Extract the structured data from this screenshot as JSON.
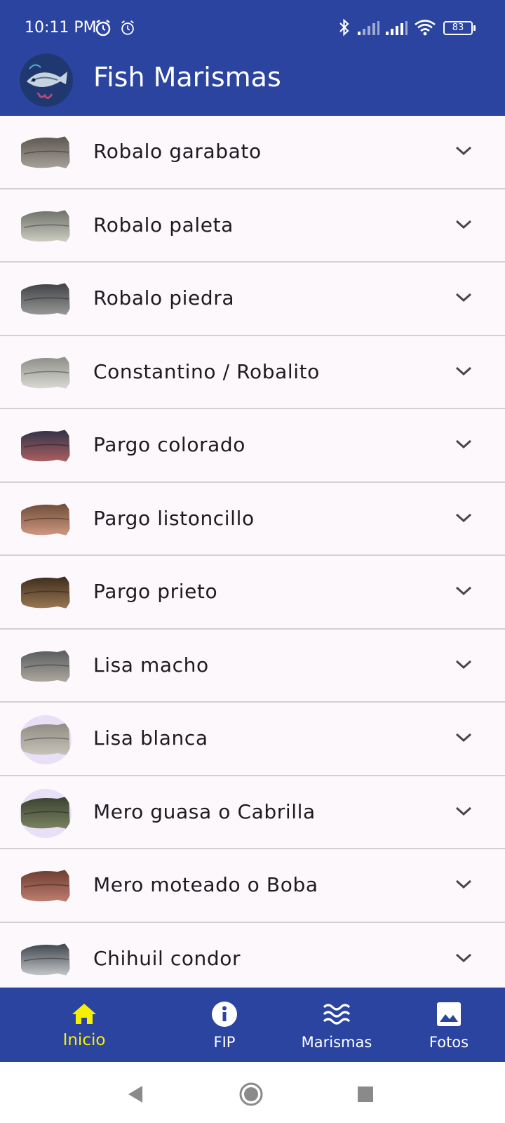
{
  "status": {
    "time": "10:11 PM",
    "battery": "83"
  },
  "app": {
    "title": "Fish Marismas"
  },
  "fish_list": [
    {
      "label": "Robalo garabato",
      "thumb": "robalo-garabato-thumb",
      "colors": [
        "#5a5550",
        "#a9a39a"
      ]
    },
    {
      "label": "Robalo paleta",
      "thumb": "robalo-paleta-thumb",
      "colors": [
        "#6b6f66",
        "#cfd0c6"
      ]
    },
    {
      "label": "Robalo piedra",
      "thumb": "robalo-piedra-thumb",
      "colors": [
        "#3c3e40",
        "#9a9c9a"
      ]
    },
    {
      "label": "Constantino / Robalito",
      "thumb": "constantino-thumb",
      "colors": [
        "#8a8c86",
        "#dcdcd6"
      ]
    },
    {
      "label": "Pargo colorado",
      "thumb": "pargo-colorado-thumb",
      "colors": [
        "#2b3248",
        "#b06060"
      ]
    },
    {
      "label": "Pargo listoncillo",
      "thumb": "pargo-listoncillo-thumb",
      "colors": [
        "#6b4a36",
        "#d29a82"
      ]
    },
    {
      "label": "Pargo prieto",
      "thumb": "pargo-prieto-thumb",
      "colors": [
        "#3a2a1c",
        "#9c7a52"
      ]
    },
    {
      "label": "Lisa macho",
      "thumb": "lisa-macho-thumb",
      "colors": [
        "#555a5e",
        "#b0aaa0"
      ]
    },
    {
      "label": "Lisa blanca",
      "thumb": "lisa-blanca-thumb",
      "colors": [
        "#8e8a82",
        "#c8c4ba"
      ]
    },
    {
      "label": "Mero guasa o Cabrilla",
      "thumb": "mero-guasa-thumb",
      "colors": [
        "#3a4030",
        "#7b8460"
      ]
    },
    {
      "label": "Mero moteado o Boba",
      "thumb": "mero-moteado-thumb",
      "colors": [
        "#6a3a30",
        "#c08070"
      ]
    },
    {
      "label": "Chihuil condor",
      "thumb": "chihuil-condor-thumb",
      "colors": [
        "#3a4048",
        "#c8cacc"
      ]
    }
  ],
  "nav": [
    {
      "label": "Inicio",
      "icon": "home-icon",
      "active": true
    },
    {
      "label": "FIP",
      "icon": "info-icon",
      "active": false
    },
    {
      "label": "Marismas",
      "icon": "waves-icon",
      "active": false
    },
    {
      "label": "Fotos",
      "icon": "image-icon",
      "active": false
    }
  ],
  "colors": {
    "primary": "#2a44a0",
    "active_nav": "#f7f000",
    "list_bg": "#fdf8fc",
    "divider": "#d3d0d6"
  }
}
